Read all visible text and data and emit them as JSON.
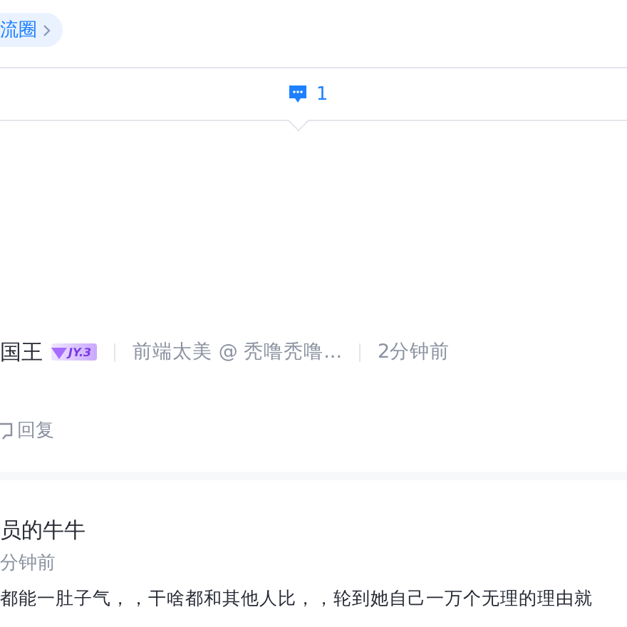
{
  "circle_tag": {
    "label": "流圈"
  },
  "comment_bar": {
    "count": "1",
    "selected": true
  },
  "comments": [
    {
      "author": "国王",
      "level_badge": "JY.3",
      "title": "前端太美 @ 秃噜秃噜...",
      "time": "2分钟前",
      "reply": "回复"
    },
    {
      "author": "员的牛牛",
      "time": "分钟前",
      "text": "都能一肚子气，，干啥都和其他人比，，轮到她自己一万个无理的理由就"
    }
  ]
}
